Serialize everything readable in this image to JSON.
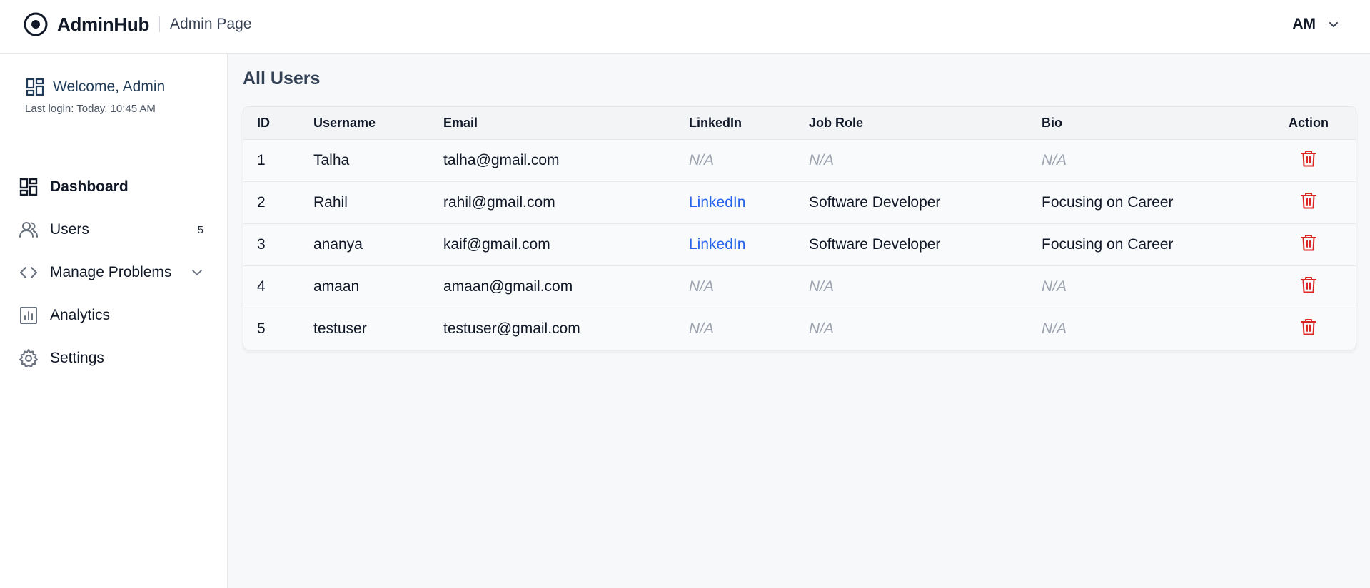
{
  "header": {
    "brand_name": "AdminHub",
    "page_name": "Admin Page",
    "user_initials": "AM"
  },
  "sidebar": {
    "welcome": "Welcome, Admin",
    "last_login": "Last login: Today, 10:45 AM",
    "items": [
      {
        "label": "Dashboard",
        "icon": "dashboard-icon",
        "active": true
      },
      {
        "label": "Users",
        "icon": "users-icon",
        "badge": "5"
      },
      {
        "label": "Manage Problems",
        "icon": "code-icon",
        "has_submenu": true
      },
      {
        "label": "Analytics",
        "icon": "analytics-icon"
      },
      {
        "label": "Settings",
        "icon": "gear-icon"
      }
    ]
  },
  "main": {
    "title": "All Users",
    "table": {
      "columns": [
        "ID",
        "Username",
        "Email",
        "LinkedIn",
        "Job Role",
        "Bio",
        "Action"
      ],
      "rows": [
        {
          "id": "1",
          "username": "Talha",
          "email": "talha@gmail.com",
          "linkedin": "N/A",
          "job_role": "N/A",
          "bio": "N/A"
        },
        {
          "id": "2",
          "username": "Rahil",
          "email": "rahil@gmail.com",
          "linkedin": "LinkedIn",
          "job_role": "Software Developer",
          "bio": "Focusing on Career"
        },
        {
          "id": "3",
          "username": "ananya",
          "email": "kaif@gmail.com",
          "linkedin": "LinkedIn",
          "job_role": "Software Developer",
          "bio": "Focusing on Career"
        },
        {
          "id": "4",
          "username": "amaan",
          "email": "amaan@gmail.com",
          "linkedin": "N/A",
          "job_role": "N/A",
          "bio": "N/A"
        },
        {
          "id": "5",
          "username": "testuser",
          "email": "testuser@gmail.com",
          "linkedin": "N/A",
          "job_role": "N/A",
          "bio": "N/A"
        }
      ]
    }
  },
  "colors": {
    "link": "#2563eb",
    "delete": "#dc2626",
    "muted": "#9ca3af",
    "title": "#334155"
  }
}
